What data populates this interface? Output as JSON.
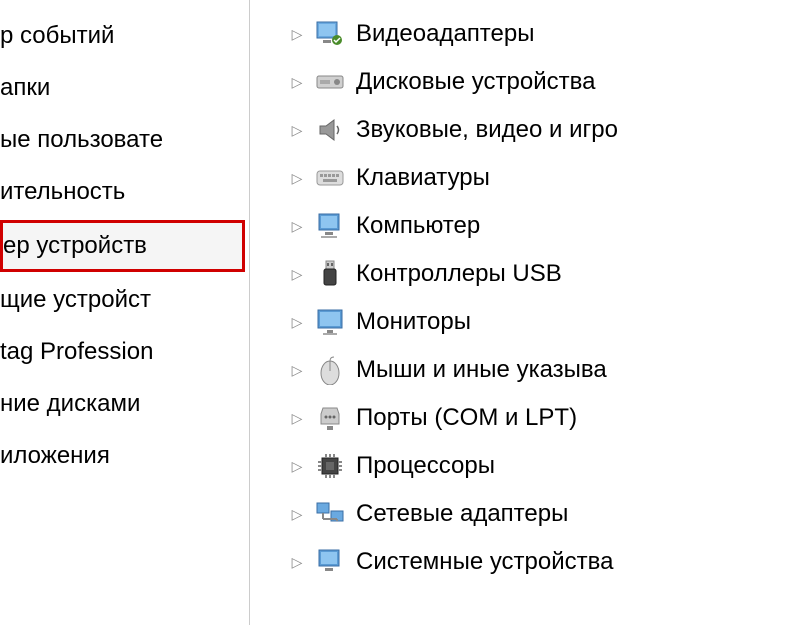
{
  "left_panel": {
    "items": [
      {
        "label": "р событий",
        "selected": false
      },
      {
        "label": "апки",
        "selected": false
      },
      {
        "label": "ые пользовате",
        "selected": false
      },
      {
        "label": "ительность",
        "selected": false
      },
      {
        "label": "ер устройств",
        "selected": true
      },
      {
        "label": "щие устройст",
        "selected": false
      },
      {
        "label": "tag Profession",
        "selected": false
      },
      {
        "label": "ние дисками",
        "selected": false
      },
      {
        "label": "иложения",
        "selected": false
      }
    ]
  },
  "device_tree": {
    "items": [
      {
        "label": "Видеоадаптеры",
        "icon": "display-adapter"
      },
      {
        "label": "Дисковые устройства",
        "icon": "disk-drive"
      },
      {
        "label": "Звуковые, видео и игро",
        "icon": "sound"
      },
      {
        "label": "Клавиатуры",
        "icon": "keyboard"
      },
      {
        "label": "Компьютер",
        "icon": "computer"
      },
      {
        "label": "Контроллеры USB",
        "icon": "usb"
      },
      {
        "label": "Мониторы",
        "icon": "monitor"
      },
      {
        "label": "Мыши и иные указыва",
        "icon": "mouse"
      },
      {
        "label": "Порты (COM и LPT)",
        "icon": "port"
      },
      {
        "label": "Процессоры",
        "icon": "processor"
      },
      {
        "label": "Сетевые адаптеры",
        "icon": "network"
      },
      {
        "label": "Системные устройства",
        "icon": "system"
      }
    ]
  }
}
